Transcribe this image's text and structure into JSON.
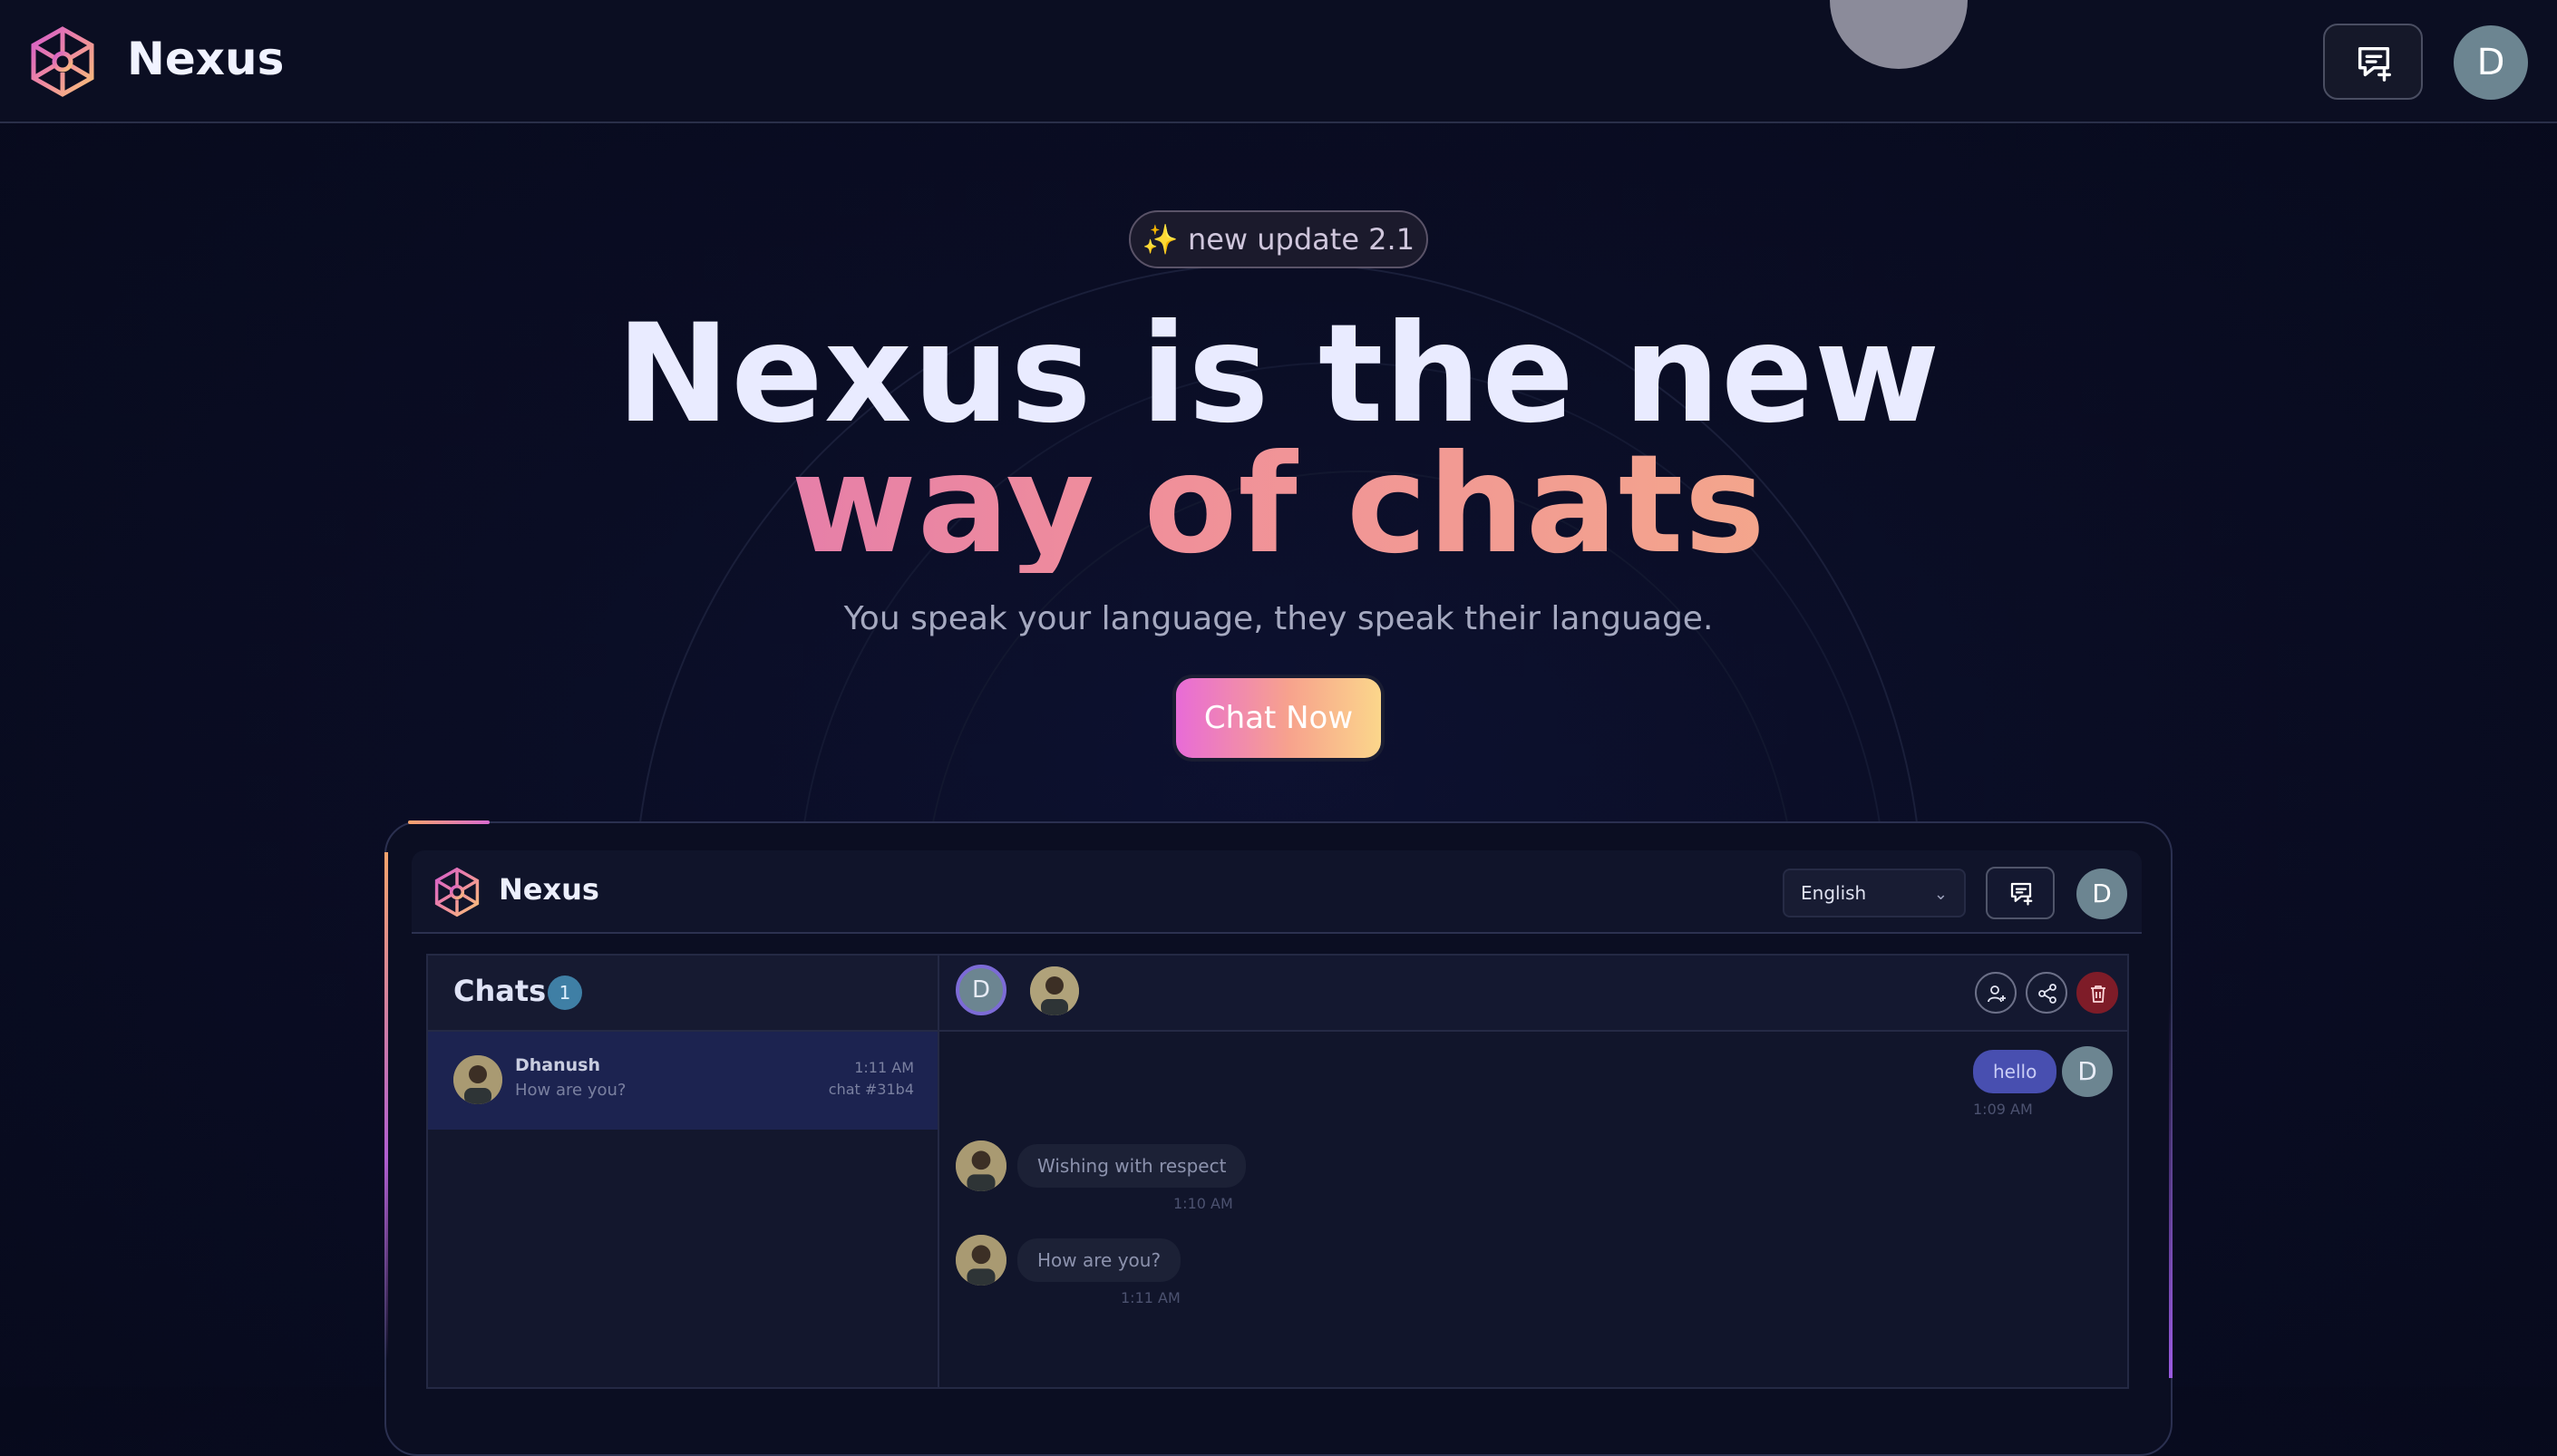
{
  "brand": {
    "name": "Nexus"
  },
  "topbar": {
    "avatar_initial": "D",
    "new_chat_icon": "message-plus-icon"
  },
  "hero": {
    "badge_icon": "✨",
    "badge_text": "new update 2.1",
    "headline_line1": "Nexus is the new",
    "headline_line2": "way of chats",
    "subtitle": "You speak your language, they speak their language.",
    "cta_label": "Chat Now"
  },
  "preview": {
    "app_title": "Nexus",
    "language": {
      "selected": "English"
    },
    "avatar_initial": "D",
    "sidebar": {
      "title": "Chats",
      "count": "1",
      "chats": [
        {
          "name": "Dhanush",
          "preview": "How are you?",
          "time": "1:11 AM",
          "chat_id": "chat #31b4"
        }
      ]
    },
    "chat": {
      "participant_initial": "D",
      "messages": [
        {
          "from": "me",
          "text": "hello",
          "time": "1:09 AM"
        },
        {
          "from": "them",
          "text": "Wishing with respect",
          "time": "1:10 AM"
        },
        {
          "from": "them",
          "text": "How are you?",
          "time": "1:11 AM"
        }
      ]
    }
  },
  "colors": {
    "background": "#0a0d24",
    "gradient_pink": "#d05cc9",
    "gradient_orange": "#f8c27a",
    "message_me": "#484fb0",
    "danger": "#7e1c28"
  }
}
